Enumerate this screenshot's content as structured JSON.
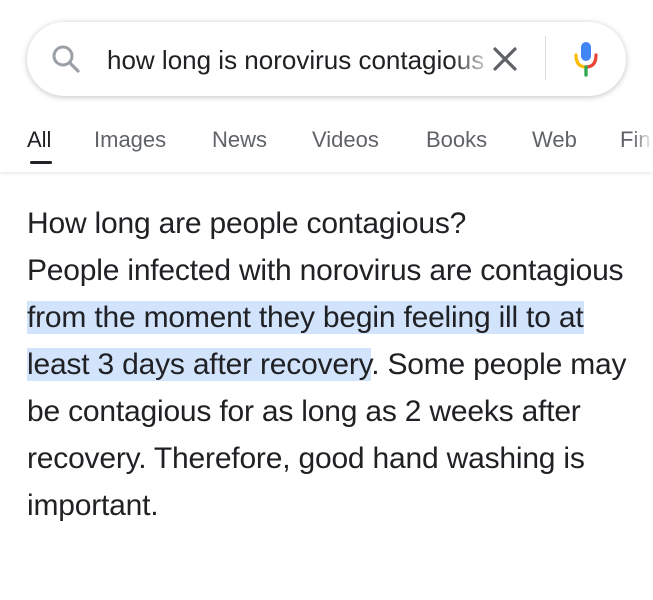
{
  "search": {
    "query": "how long is norovirus contagious",
    "clear_icon": "close-icon",
    "voice_icon": "mic-icon",
    "search_icon": "search-icon"
  },
  "tabs": [
    {
      "label": "All",
      "active": true
    },
    {
      "label": "Images"
    },
    {
      "label": "News"
    },
    {
      "label": "Videos"
    },
    {
      "label": "Books"
    },
    {
      "label": "Web"
    },
    {
      "label": "Fin"
    }
  ],
  "answer": {
    "heading": "How long are people contagious?",
    "lead": "People infected with norovirus are contagious ",
    "highlight": "from the moment they begin feeling ill to at least 3 days after recovery",
    "rest": ". Some people may be contagious for as long as 2 weeks after recovery. Therefore, good hand washing is important."
  },
  "colors": {
    "highlight": "#d2e3fc",
    "mic_blue": "#4285f4",
    "mic_red": "#ea4335",
    "mic_yellow": "#fbbc04",
    "mic_green": "#34a853"
  }
}
